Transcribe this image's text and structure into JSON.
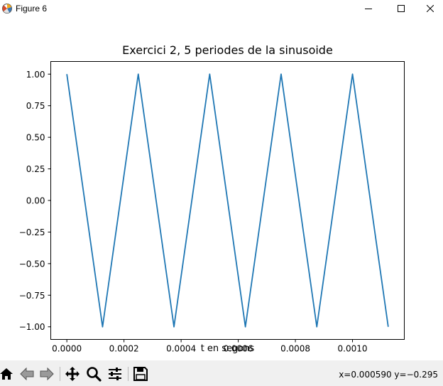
{
  "window": {
    "title": "Figure 6",
    "icon": "matplotlib-icon",
    "controls": [
      "minimize-icon",
      "maximize-icon",
      "close-icon"
    ]
  },
  "toolbar": {
    "tools": [
      "home-icon",
      "back-arrow-icon",
      "forward-arrow-icon",
      "pan-move-icon",
      "zoom-magnifier-icon",
      "configure-subplots-icon",
      "save-floppy-icon"
    ],
    "coordinates": "x=0.000590 y=−0.295"
  },
  "chart_data": {
    "type": "line",
    "title": "Exercici 2, 5 periodes de la sinusoide",
    "xlabel": "t en segons",
    "ylabel": "",
    "xlim": [
      -5.63e-05,
      0.0011813
    ],
    "ylim": [
      -1.1,
      1.1
    ],
    "grid": false,
    "color": "#1f77b4",
    "xticks": [
      0.0,
      0.0002,
      0.0004,
      0.0006,
      0.0008,
      0.001
    ],
    "xtick_labels": [
      "0.0000",
      "0.0002",
      "0.0004",
      "0.0006",
      "0.0008",
      "0.0010"
    ],
    "yticks": [
      -1.0,
      -0.75,
      -0.5,
      -0.25,
      0.0,
      0.25,
      0.5,
      0.75,
      1.0
    ],
    "ytick_labels": [
      "−1.00",
      "−0.75",
      "−0.50",
      "−0.25",
      "0.00",
      "0.25",
      "0.50",
      "0.75",
      "1.00"
    ],
    "series": [
      {
        "x": [
          0.0,
          0.000125,
          0.00025,
          0.000375,
          0.0005,
          0.000625,
          0.00075,
          0.000875,
          0.001,
          0.001125
        ],
        "y": [
          1.0,
          -1.0,
          1.0,
          -1.0,
          1.0,
          -1.0,
          1.0,
          -1.0,
          1.0,
          -1.0
        ]
      }
    ]
  }
}
